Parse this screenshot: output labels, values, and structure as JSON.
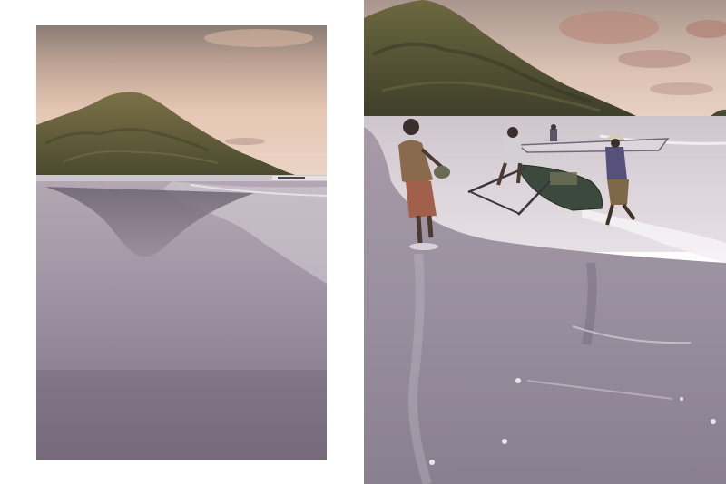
{
  "layout": "two-photo-spread",
  "photos": [
    {
      "id": "left",
      "subject": "hill-reflected-on-wet-beach-at-dusk"
    },
    {
      "id": "right",
      "subject": "fishermen-pulling-boat-on-shore"
    }
  ],
  "colors": {
    "background": "#ffffff",
    "sky_top": "#8c8078",
    "sky_bottom": "#e6c9b7",
    "hill": "#5f5a3a",
    "sand": "#8f8495",
    "water": "#ddd7dc"
  }
}
